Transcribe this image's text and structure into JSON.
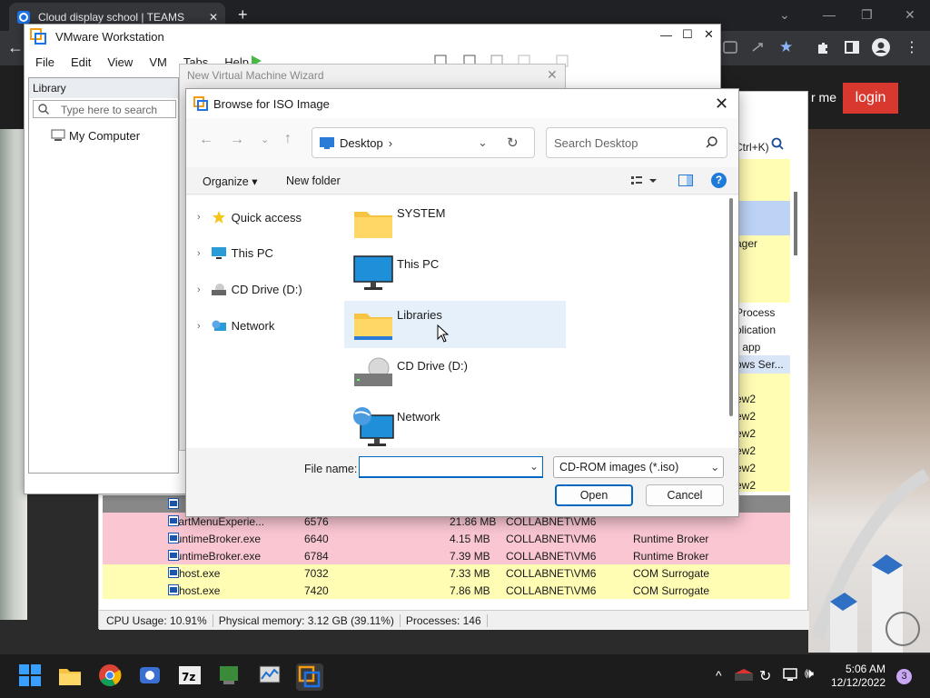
{
  "browser": {
    "tab_title": "Cloud display school | TEAMS",
    "new_tab_symbol": "+",
    "win_min": "—",
    "win_max": "❐",
    "win_close": "✕"
  },
  "website": {
    "nav_fragment": "r me",
    "login_label": "login"
  },
  "task_manager": {
    "right_fragments": [
      "Ctrl+K)",
      "ager",
      "Process",
      "olication",
      "r app",
      "ows Ser...",
      "ew2",
      "ew2",
      "ew2",
      "ew2",
      "ew2",
      "ew2"
    ],
    "rows": [
      {
        "name": "StartMenuExperie...",
        "pid": "6576",
        "cpu": "",
        "mem": "21.86 MB",
        "user": "COLLABNET\\VM6",
        "desc": "",
        "color": "pink"
      },
      {
        "name": "RuntimeBroker.exe",
        "pid": "6640",
        "cpu": "",
        "mem": "4.15 MB",
        "user": "COLLABNET\\VM6",
        "desc": "Runtime Broker",
        "color": "pink"
      },
      {
        "name": "RuntimeBroker.exe",
        "pid": "6784",
        "cpu": "",
        "mem": "7.39 MB",
        "user": "COLLABNET\\VM6",
        "desc": "Runtime Broker",
        "color": "pink"
      },
      {
        "name": "dllhost.exe",
        "pid": "7032",
        "cpu": "",
        "mem": "7.33 MB",
        "user": "COLLABNET\\VM6",
        "desc": "COM Surrogate",
        "color": "yel"
      },
      {
        "name": "dllhost.exe",
        "pid": "7420",
        "cpu": "",
        "mem": "7.86 MB",
        "user": "COLLABNET\\VM6",
        "desc": "COM Surrogate",
        "color": "yel"
      }
    ],
    "status": {
      "cpu": "CPU Usage: 10.91%",
      "mem": "Physical memory: 3.12 GB (39.11%)",
      "proc": "Processes: 146"
    }
  },
  "vmware": {
    "title": "VMware Workstation",
    "menu": [
      "File",
      "Edit",
      "View",
      "VM",
      "Tabs",
      "Help"
    ],
    "library_title": "Library",
    "library_search_placeholder": "Type here to search",
    "tree_item": "My Computer"
  },
  "wizard": {
    "title": "New Virtual Machine Wizard"
  },
  "dialog": {
    "title": "Browse for ISO Image",
    "address": "Desktop",
    "search_placeholder": "Search Desktop",
    "organize_label": "Organize",
    "new_folder_label": "New folder",
    "help_symbol": "?",
    "nav_pane": [
      {
        "label": "Quick access",
        "icon": "star-icon"
      },
      {
        "label": "This PC",
        "icon": "pc-icon"
      },
      {
        "label": "CD Drive (D:)",
        "icon": "cd-drive-icon"
      },
      {
        "label": "Network",
        "icon": "network-icon"
      }
    ],
    "files": [
      {
        "label": "SYSTEM",
        "icon": "folder-icon"
      },
      {
        "label": "This PC",
        "icon": "monitor-icon"
      },
      {
        "label": "Libraries",
        "icon": "folder-icon",
        "selected": true
      },
      {
        "label": "CD Drive (D:)",
        "icon": "cd-drive-icon"
      },
      {
        "label": "Network",
        "icon": "network-icon"
      }
    ],
    "file_name_label": "File name:",
    "file_name_value": "",
    "file_type": "CD-ROM images (*.iso)",
    "open_label": "Open",
    "cancel_label": "Cancel"
  },
  "taskbar": {
    "time": "5:06 AM",
    "date": "12/12/2022",
    "notification_count": "3"
  },
  "colors": {
    "accent": "#0067c0",
    "login": "#d9382f",
    "selection": "#e5f0fb",
    "tm_pink": "#f9c6d2",
    "tm_yellow": "#fffcb4"
  }
}
